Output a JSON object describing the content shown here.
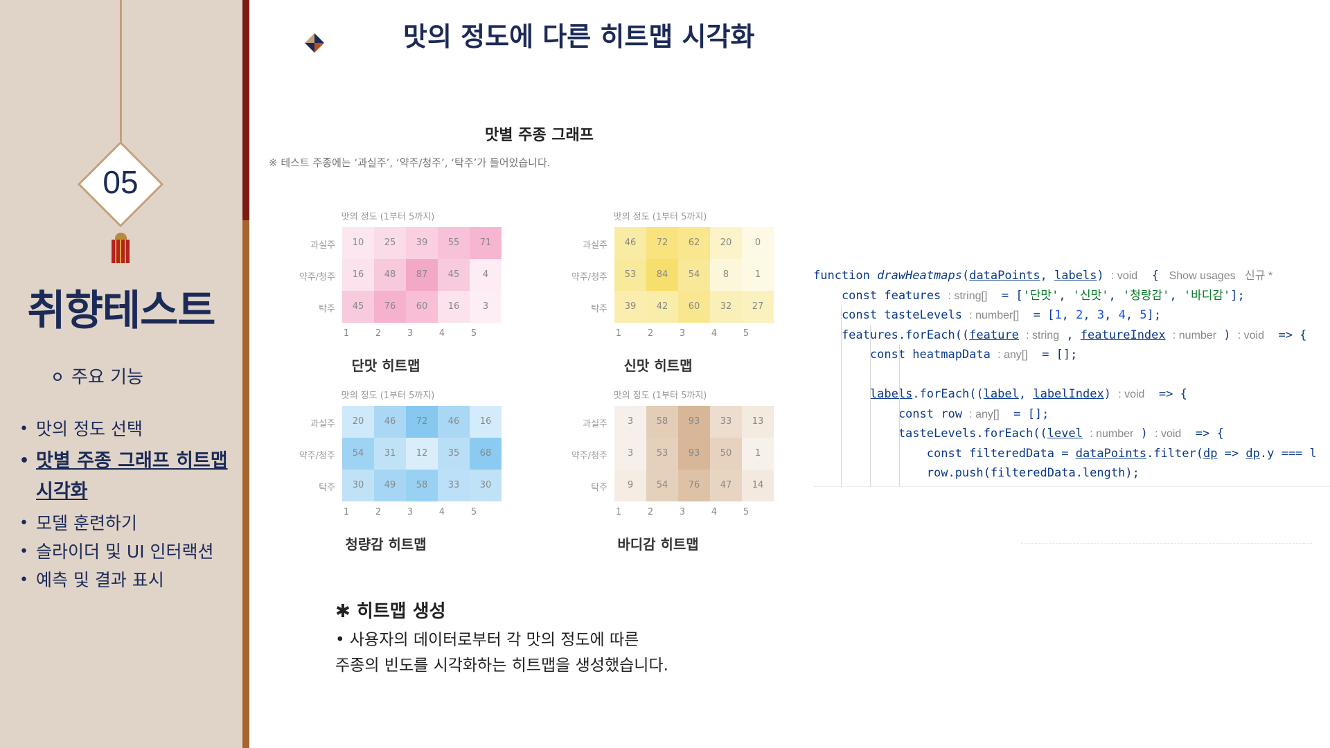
{
  "sidebar": {
    "section_number": "05",
    "title": "취향테스트",
    "subheading": "주요 기능",
    "items": [
      {
        "label": "맛의 정도 선택"
      },
      {
        "label": "맛별 주종 그래프 히트맵 시각화"
      },
      {
        "label": "모델 훈련하기"
      },
      {
        "label": "슬라이더 및 UI 인터랙션"
      },
      {
        "label": "예측 및 결과 표시"
      }
    ]
  },
  "header": {
    "title": "맛의 정도에 다른 히트맵 시각화"
  },
  "figure": {
    "title": "맛별 주종 그래프",
    "note": "※ 테스트 주종에는 ‘과실주’, ‘약주/청주’, ‘탁주’가 들어있습니다."
  },
  "chart_data": [
    {
      "type": "heatmap",
      "title": "단맛 히트맵",
      "subtitle": "맛의 정도 (1부터 5까지)",
      "x": [
        1,
        2,
        3,
        4,
        5
      ],
      "y": [
        "과실주",
        "약주/청주",
        "탁주"
      ],
      "values": [
        [
          10,
          25,
          39,
          55,
          71
        ],
        [
          16,
          48,
          87,
          45,
          4
        ],
        [
          45,
          76,
          60,
          16,
          3
        ]
      ],
      "colormap": "pink",
      "max_color": "#f4a8c8"
    },
    {
      "type": "heatmap",
      "title": "신맛 히트맵",
      "subtitle": "맛의 정도 (1부터 5까지)",
      "x": [
        1,
        2,
        3,
        4,
        5
      ],
      "y": [
        "과실주",
        "약주/청주",
        "탁주"
      ],
      "values": [
        [
          46,
          72,
          62,
          20,
          0
        ],
        [
          53,
          84,
          54,
          8,
          1
        ],
        [
          39,
          42,
          60,
          32,
          27
        ]
      ],
      "colormap": "yellow",
      "max_color": "#f7df6e"
    },
    {
      "type": "heatmap",
      "title": "청량감 히트맵",
      "subtitle": "맛의 정도 (1부터 5까지)",
      "x": [
        1,
        2,
        3,
        4,
        5
      ],
      "y": [
        "과실주",
        "약주/청주",
        "탁주"
      ],
      "values": [
        [
          20,
          46,
          72,
          46,
          16
        ],
        [
          54,
          31,
          12,
          35,
          68
        ],
        [
          30,
          49,
          58,
          33,
          30
        ]
      ],
      "colormap": "blue",
      "max_color": "#86c8f0"
    },
    {
      "type": "heatmap",
      "title": "바디감 히트맵",
      "subtitle": "맛의 정도 (1부터 5까지)",
      "x": [
        1,
        2,
        3,
        4,
        5
      ],
      "y": [
        "과실주",
        "약주/청주",
        "탁주"
      ],
      "values": [
        [
          3,
          58,
          93,
          33,
          13
        ],
        [
          3,
          53,
          93,
          50,
          1
        ],
        [
          9,
          54,
          76,
          47,
          14
        ]
      ],
      "colormap": "tan",
      "max_color": "#d7b797"
    }
  ],
  "code": {
    "lines": [
      [
        {
          "t": "function ",
          "c": "kw"
        },
        {
          "t": "drawHeatmaps",
          "c": "fn"
        },
        {
          "t": "("
        },
        {
          "t": "dataPoints",
          "c": "u"
        },
        {
          "t": ", "
        },
        {
          "t": "labels",
          "c": "u"
        },
        {
          "t": ") "
        },
        {
          "t": ": void",
          "c": "hint"
        },
        {
          "t": "  { "
        },
        {
          "t": " Show usages   신규 *",
          "c": "hint"
        }
      ],
      [
        {
          "t": "    const features "
        },
        {
          "t": ": string[]",
          "c": "hint"
        },
        {
          "t": "  = ["
        },
        {
          "t": "'단맛'",
          "c": "str"
        },
        {
          "t": ", "
        },
        {
          "t": "'신맛'",
          "c": "str"
        },
        {
          "t": ", "
        },
        {
          "t": "'청량감'",
          "c": "str"
        },
        {
          "t": ", "
        },
        {
          "t": "'바디감'",
          "c": "str"
        },
        {
          "t": "];"
        }
      ],
      [
        {
          "t": "    const tasteLevels "
        },
        {
          "t": ": number[]",
          "c": "hint"
        },
        {
          "t": "  = ["
        },
        {
          "t": "1",
          "c": "num"
        },
        {
          "t": ", "
        },
        {
          "t": "2",
          "c": "num"
        },
        {
          "t": ", "
        },
        {
          "t": "3",
          "c": "num"
        },
        {
          "t": ", "
        },
        {
          "t": "4",
          "c": "num"
        },
        {
          "t": ", "
        },
        {
          "t": "5",
          "c": "num"
        },
        {
          "t": "];"
        }
      ],
      [
        {
          "t": "    features.forEach(("
        },
        {
          "t": "feature",
          "c": "u"
        },
        {
          "t": " "
        },
        {
          "t": ": string",
          "c": "hint"
        },
        {
          "t": " , "
        },
        {
          "t": "featureIndex",
          "c": "u"
        },
        {
          "t": " "
        },
        {
          "t": ": number",
          "c": "hint"
        },
        {
          "t": " ) "
        },
        {
          "t": ": void",
          "c": "hint"
        },
        {
          "t": "  => {"
        }
      ],
      [
        {
          "t": "        const heatmapData "
        },
        {
          "t": ": any[]",
          "c": "hint"
        },
        {
          "t": "  = [];"
        }
      ],
      [
        {
          "t": ""
        }
      ],
      [
        {
          "t": "        "
        },
        {
          "t": "labels",
          "c": "u"
        },
        {
          "t": ".forEach(("
        },
        {
          "t": "label",
          "c": "u"
        },
        {
          "t": ", "
        },
        {
          "t": "labelIndex",
          "c": "u"
        },
        {
          "t": ") "
        },
        {
          "t": ": void",
          "c": "hint"
        },
        {
          "t": "  => {"
        }
      ],
      [
        {
          "t": "            const row "
        },
        {
          "t": ": any[]",
          "c": "hint"
        },
        {
          "t": "  = [];"
        }
      ],
      [
        {
          "t": "            tasteLevels.forEach(("
        },
        {
          "t": "level",
          "c": "u"
        },
        {
          "t": " "
        },
        {
          "t": ": number",
          "c": "hint"
        },
        {
          "t": " ) "
        },
        {
          "t": ": void",
          "c": "hint"
        },
        {
          "t": "  => {"
        }
      ],
      [
        {
          "t": "                const filteredData = "
        },
        {
          "t": "dataPoints",
          "c": "u"
        },
        {
          "t": ".filter("
        },
        {
          "t": "dp",
          "c": "u"
        },
        {
          "t": " => "
        },
        {
          "t": "dp",
          "c": "u"
        },
        {
          "t": ".y === l"
        }
      ],
      [
        {
          "t": "                row.push(filteredData.length);"
        }
      ]
    ]
  },
  "bottom": {
    "heading": "✱ 히트맵 생성",
    "line1": "• 사용자의 데이터로부터 각 맛의 정도에 따른",
    "line2": "주종의 빈도를 시각화하는 히트맵을 생성했습니다."
  }
}
